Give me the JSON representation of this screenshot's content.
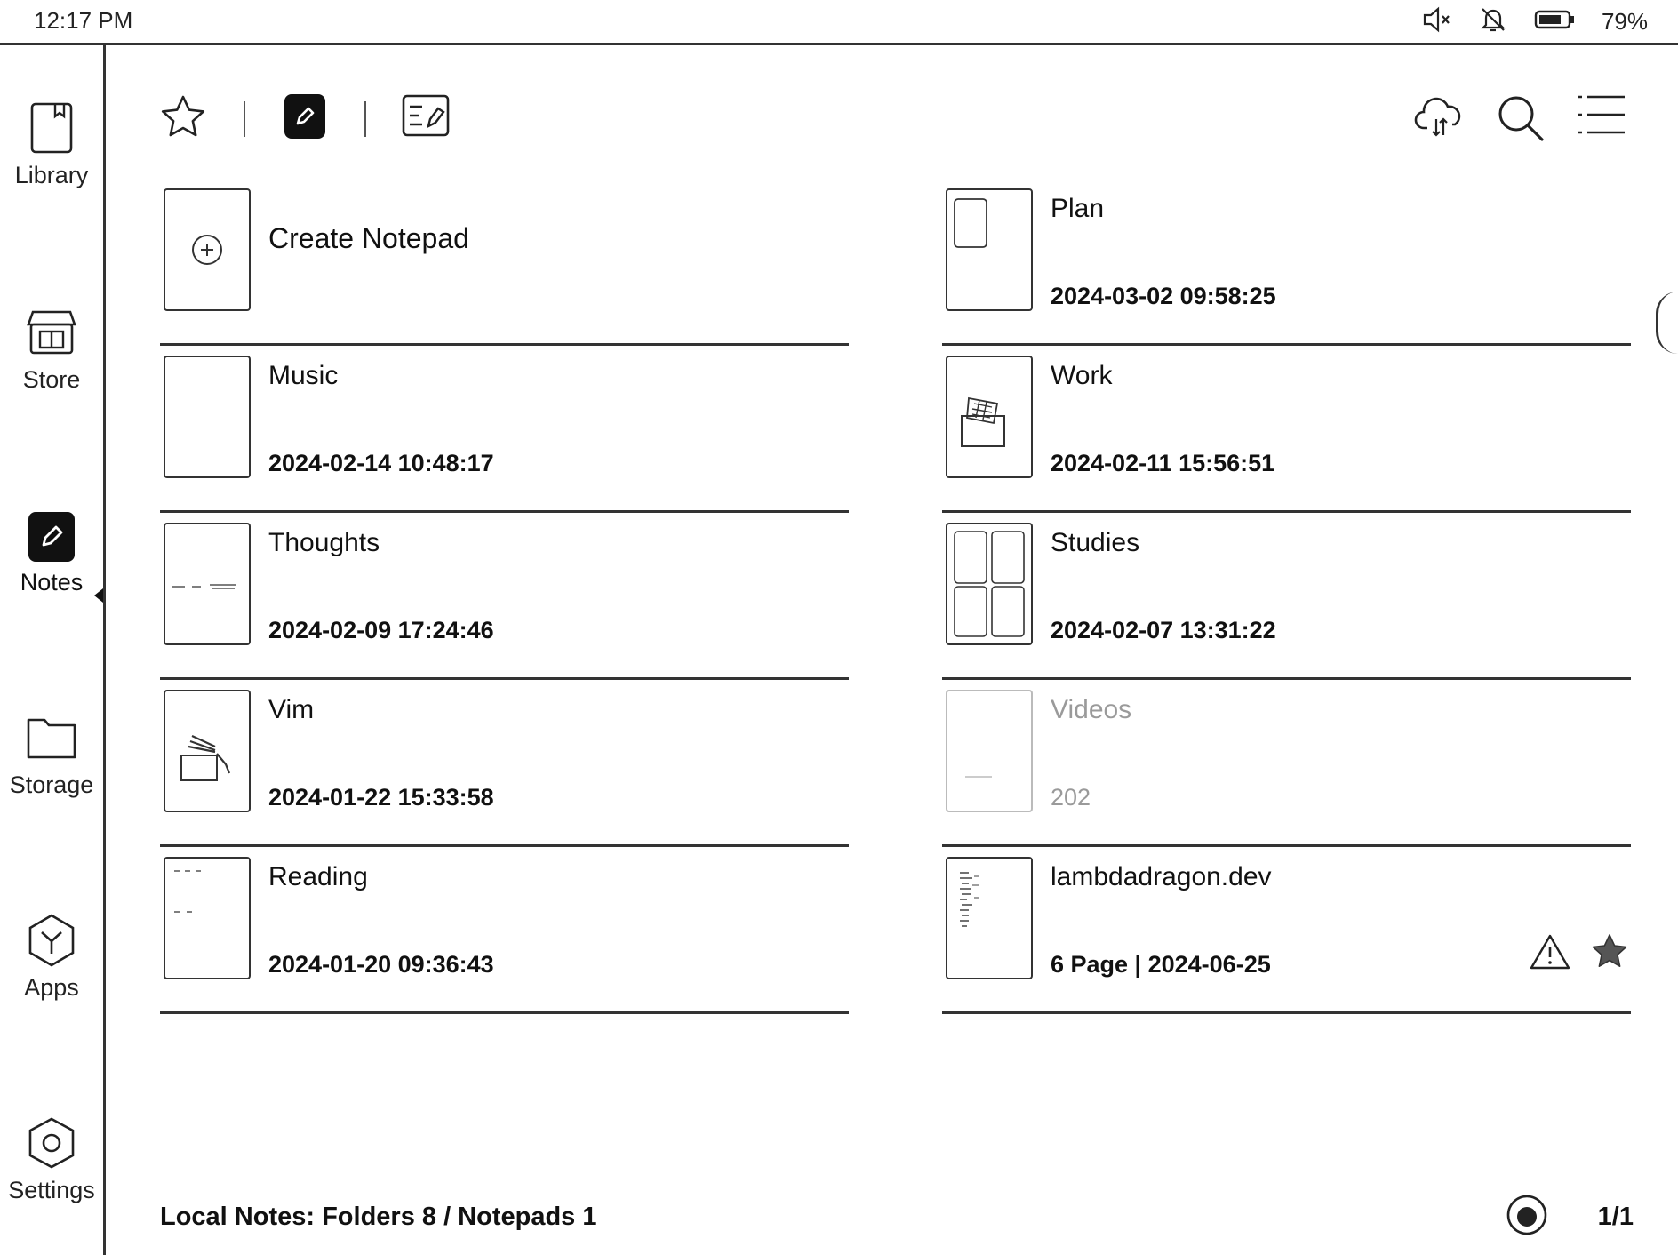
{
  "status_bar": {
    "time": "12:17 PM",
    "battery_percent": "79%",
    "battery_level": 0.79,
    "icons": [
      "mute-icon",
      "notifications-off-icon",
      "battery-icon"
    ]
  },
  "sidebar": {
    "items": [
      {
        "label": "Library",
        "icon": "book-icon",
        "active": false
      },
      {
        "label": "Store",
        "icon": "store-icon",
        "active": false
      },
      {
        "label": "Notes",
        "icon": "pencil-icon",
        "active": true
      },
      {
        "label": "Storage",
        "icon": "folder-icon",
        "active": false
      },
      {
        "label": "Apps",
        "icon": "apps-icon",
        "active": false
      },
      {
        "label": "Settings",
        "icon": "settings-icon",
        "active": false
      }
    ]
  },
  "toolbar": {
    "left_icons": [
      "star-icon",
      "pencil-icon",
      "notebook-list-icon"
    ],
    "right_icons": [
      "cloud-sync-icon",
      "search-icon",
      "menu-icon"
    ]
  },
  "notes": {
    "left": [
      {
        "title": "Create Notepad",
        "date": ""
      },
      {
        "title": "Music",
        "date": "2024-02-14 10:48:17"
      },
      {
        "title": "Thoughts",
        "date": "2024-02-09 17:24:46"
      },
      {
        "title": "Vim",
        "date": "2024-01-22 15:33:58"
      },
      {
        "title": "Reading",
        "date": "2024-01-20 09:36:43"
      }
    ],
    "right": [
      {
        "title": "Plan",
        "date": "2024-03-02 09:58:25"
      },
      {
        "title": "Work",
        "date": "2024-02-11 15:56:51"
      },
      {
        "title": "Studies",
        "date": "2024-02-07 13:31:22"
      },
      {
        "title": "Videos",
        "date": "202"
      },
      {
        "title": "lambdadragon.dev",
        "date": "6 Page | 2024-06-25",
        "badges": [
          "warning-icon",
          "star-filled-icon"
        ]
      }
    ]
  },
  "footer": {
    "summary": "Local Notes: Folders 8 / Notepads 1",
    "page": "1/1"
  }
}
